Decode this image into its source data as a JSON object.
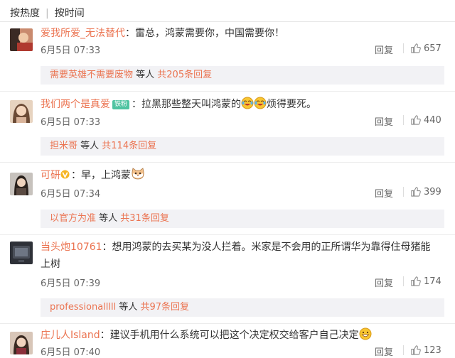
{
  "tabs": {
    "hot": "按热度",
    "time": "按时间"
  },
  "colors": {
    "username": "#eb7350",
    "text": "#333333",
    "meta": "#666666",
    "subbg": "#f2f2f5"
  },
  "comments": [
    {
      "user": "爱我所爱_无法替代",
      "colon": "：",
      "text": "雷总，鸿蒙需要你，中国需要你！",
      "date": "6月5日 07:33",
      "reply": "回复",
      "likes": "657",
      "sub": {
        "user": "需要英雄不需要废物",
        "mid": " 等人 ",
        "count": "共205条回复"
      }
    },
    {
      "user": "我们两个是真爱",
      "badge": "铁粉",
      "colon": "：",
      "text": "拉黑那些整天叫鸿蒙的",
      "text_tail": "烦得要死。",
      "date": "6月5日 07:33",
      "reply": "回复",
      "likes": "440",
      "sub": {
        "user": "担米哥",
        "mid": " 等人 ",
        "count": "共114条回复"
      }
    },
    {
      "user": "可研",
      "colon": "：",
      "text": "早，上鸿蒙",
      "date": "6月5日 07:34",
      "reply": "回复",
      "likes": "399",
      "sub": {
        "user": "以官方为准",
        "mid": " 等人 ",
        "count": "共31条回复"
      }
    },
    {
      "user": "当头炮10761",
      "colon": "：",
      "text": "想用鸿蒙的去买某为没人拦着。米家是不会用的正所谓华为靠得住母猪能",
      "text_line2": "上树",
      "date": "6月5日 07:39",
      "reply": "回复",
      "likes": "174",
      "sub": {
        "user": "professionalllll",
        "mid": " 等人 ",
        "count": "共97条回复"
      }
    },
    {
      "user": "庄儿人Island",
      "colon": "：",
      "text": "建议手机用什么系统可以把这个决定权交给客户自己决定",
      "date": "6月5日 07:40",
      "reply": "回复",
      "likes": "123"
    }
  ],
  "icons": [
    "thumb-up-icon",
    "laugh-cry-emoji",
    "cat-emoji",
    "grin-emoji",
    "v-badge-icon"
  ]
}
